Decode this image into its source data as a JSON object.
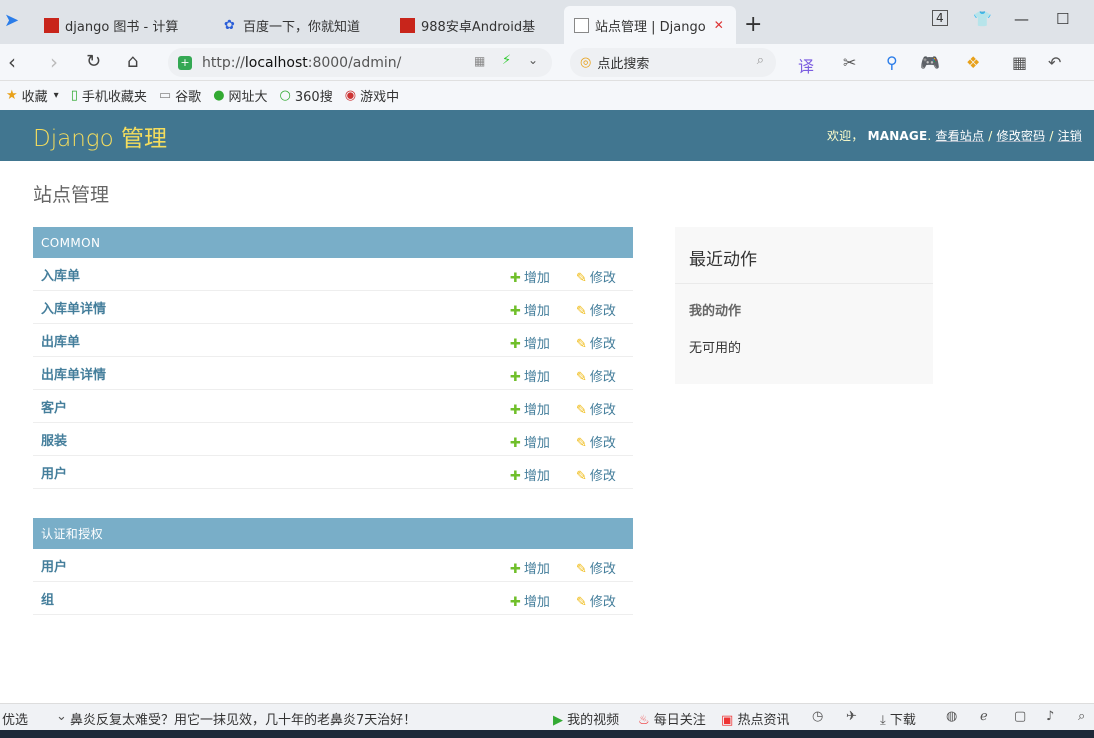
{
  "browser": {
    "tabs": [
      {
        "title": "django 图书 - 计算",
        "active": false
      },
      {
        "title": "百度一下，你就知道",
        "active": false
      },
      {
        "title": "988安卓Android基",
        "active": false
      },
      {
        "title": "站点管理 | Django",
        "active": true
      }
    ],
    "tab_count": "4",
    "url": {
      "prefix": "http://",
      "host": "localhost",
      "rest": ":8000/admin/"
    },
    "search_placeholder": "点此搜索",
    "bookmarks": [
      "收藏",
      "手机收藏夹",
      "谷歌",
      "网址大",
      "360搜",
      "游戏中"
    ]
  },
  "admin": {
    "branding": "Django 管理",
    "welcome": "欢迎，",
    "username": "MANAGE",
    "view_site": "查看站点",
    "change_password": "修改密码",
    "logout": "注销",
    "page_title": "站点管理",
    "add_label": "增加",
    "change_label": "修改",
    "modules": [
      {
        "caption": "COMMON",
        "models": [
          "入库单",
          "入库单详情",
          "出库单",
          "出库单详情",
          "客户",
          "服装",
          "用户"
        ]
      },
      {
        "caption": "认证和授权",
        "models": [
          "用户",
          "组"
        ]
      }
    ],
    "recent": {
      "title": "最近动作",
      "subtitle": "我的动作",
      "empty": "无可用的"
    }
  },
  "statusbar": {
    "left": "优选",
    "ad": "鼻炎反复太难受？用它一抹见效，几十年的老鼻炎7天治好！",
    "video": "我的视频",
    "daily": "每日关注",
    "hot": "热点资讯",
    "download": "下载"
  },
  "colors": {
    "header": "#417690",
    "caption": "#79aec8",
    "branding": "#f5dd5d",
    "link": "#447e9b"
  }
}
